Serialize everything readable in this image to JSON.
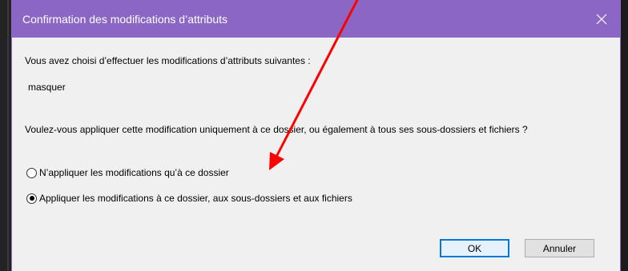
{
  "dialog": {
    "title": "Confirmation des modifications d’attributs",
    "intro": "Vous avez choisi d’effectuer les modifications d’attributs suivantes :",
    "attribute": "masquer",
    "question": "Voulez-vous appliquer cette modification uniquement à ce dossier, ou également à tous ses sous-dossiers et fichiers ?",
    "options": [
      {
        "label": "N’appliquer les modifications qu’à ce dossier",
        "selected": false
      },
      {
        "label": "Appliquer les modifications à ce dossier, aux sous-dossiers et aux fichiers",
        "selected": true
      }
    ],
    "ok_label": "OK",
    "cancel_label": "Annuler",
    "close_icon": "close-icon"
  },
  "colors": {
    "titlebar": "#8c66c4",
    "dialog_bg": "#f0f0f0",
    "default_button_border": "#0078d7",
    "annotation_arrow": "#ff0000"
  }
}
